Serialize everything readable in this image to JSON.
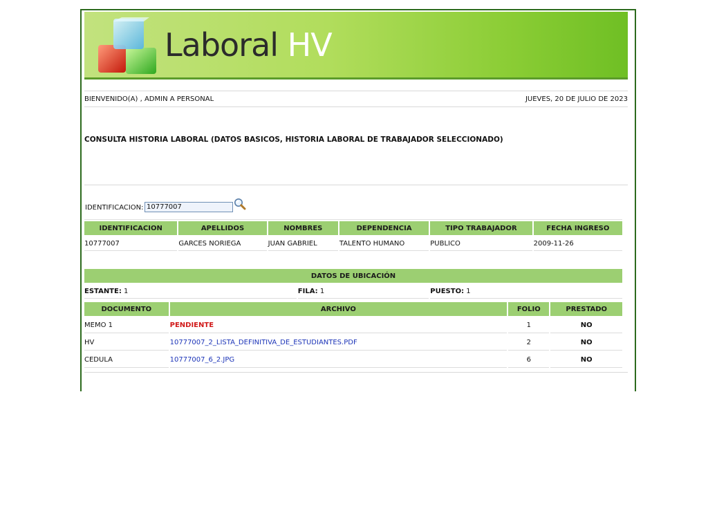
{
  "brand": {
    "word1": "Laboral",
    "word2": "HV"
  },
  "header": {
    "welcome": "BIENVENIDO(A) , ADMIN A PERSONAL",
    "date": "JUEVES, 20 DE JULIO DE 2023"
  },
  "page_title": "CONSULTA HISTORIA LABORAL (DATOS BASICOS, HISTORIA LABORAL DE TRABAJADOR SELECCIONADO)",
  "search": {
    "label": "IDENTIFICACION:",
    "value": "10777007",
    "icon": "magnifier-icon"
  },
  "worker_table": {
    "headers": [
      "IDENTIFICACION",
      "APELLIDOS",
      "NOMBRES",
      "DEPENDENCIA",
      "TIPO TRABAJADOR",
      "FECHA INGRESO"
    ],
    "row": [
      "10777007",
      "GARCES NORIEGA",
      "JUAN GABRIEL",
      "TALENTO HUMANO",
      "PUBLICO",
      "2009-11-26"
    ]
  },
  "location": {
    "title": "DATOS DE UBICACIÓN",
    "estante_label": "ESTANTE:",
    "estante_value": "1",
    "fila_label": "FILA:",
    "fila_value": "1",
    "puesto_label": "PUESTO:",
    "puesto_value": "1"
  },
  "documents": {
    "headers": [
      "DOCUMENTO",
      "ARCHIVO",
      "FOLIO",
      "PRESTADO"
    ],
    "rows": [
      {
        "doc": "MEMO 1",
        "file": "PENDIENTE",
        "folio": "1",
        "prestado": "NO"
      },
      {
        "doc": "HV",
        "file": "10777007_2_LISTA_DEFINITIVA_DE_ESTUDIANTES.PDF",
        "folio": "2",
        "prestado": "NO"
      },
      {
        "doc": "CEDULA",
        "file": "10777007_6_2.JPG",
        "folio": "6",
        "prestado": "NO"
      }
    ]
  },
  "colors": {
    "header_green": "#9ccf72",
    "border_green": "#2c6a1d",
    "pending_red": "#d11a1a",
    "link_blue": "#1c34b8"
  }
}
